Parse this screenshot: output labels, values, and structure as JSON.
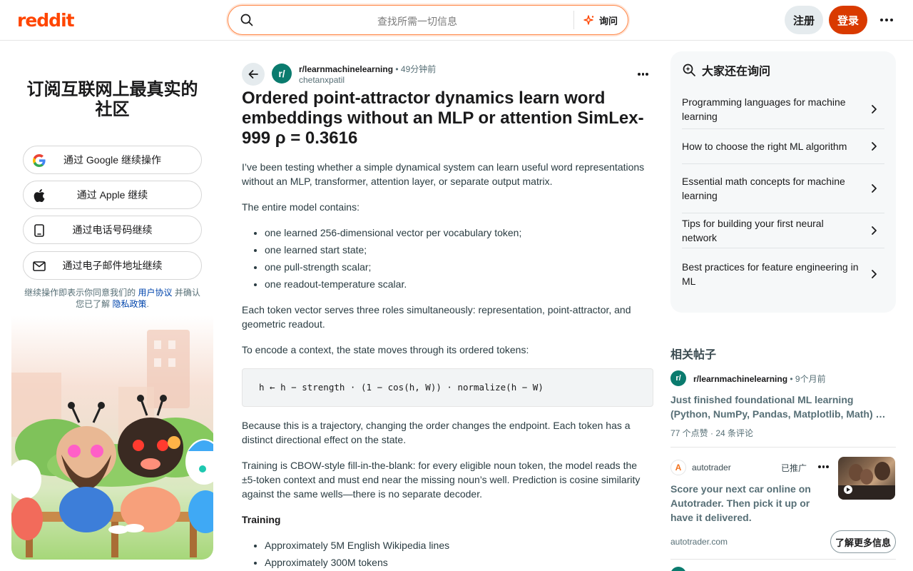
{
  "header": {
    "logo": "reddit",
    "search_placeholder": "查找所需一切信息",
    "ask_label": "询问",
    "signup_label": "注册",
    "login_label": "登录"
  },
  "left_card": {
    "title": "订阅互联网上最真实的社区",
    "buttons": [
      {
        "label": "通过 Google 继续操作",
        "icon": "google-icon"
      },
      {
        "label": "通过 Apple 继续",
        "icon": "apple-icon"
      },
      {
        "label": "通过电话号码继续",
        "icon": "phone-icon"
      },
      {
        "label": "通过电子邮件地址继续",
        "icon": "mail-icon"
      }
    ],
    "terms_prefix": "继续操作即表示你同意我们的",
    "terms_link": "用户协议",
    "terms_middle": "并确认您已了解",
    "privacy_link": "隐私政策",
    "terms_suffix": "."
  },
  "post": {
    "subreddit": "r/learnmachinelearning",
    "time": "• 49分钟前",
    "author": "chetanxpatil",
    "title": "Ordered point-attractor dynamics learn word embeddings without an MLP or attention SimLex-999 ρ = 0.3616",
    "p1": "I’ve been testing whether a simple dynamical system can learn useful word representations without an MLP, transformer, attention layer, or separate output matrix.",
    "p2": "The entire model contains:",
    "list1": [
      "one learned 256-dimensional vector per vocabulary token;",
      "one learned start state;",
      "one pull-strength scalar;",
      "one readout-temperature scalar."
    ],
    "p3": "Each token vector serves three roles simultaneously: representation, point-attractor, and geometric readout.",
    "p4": "To encode a context, the state moves through its ordered tokens:",
    "code": "h ← h − strength · (1 − cos(h, W)) · normalize(h − W)",
    "p5": "Because this is a trajectory, changing the order changes the endpoint. Each token has a distinct directional effect on the state.",
    "p6": "Training is CBOW-style fill-in-the-blank: for every eligible noun token, the model reads the ±5-token context and must end near the missing noun’s well. Prediction is cosine similarity against the same wells—there is no separate decoder.",
    "h_training": "Training",
    "list2": [
      "Approximately 5M English Wikipedia lines",
      "Approximately 300M tokens"
    ]
  },
  "ask_card": {
    "title": "大家还在询问",
    "items": [
      "Programming languages for machine learning",
      "How to choose the right ML algorithm",
      "Essential math concepts for machine learning",
      "Tips for building your first neural network",
      "Best practices for feature engineering in ML"
    ]
  },
  "related": {
    "title": "相关帖子",
    "post1": {
      "subreddit": "r/learnmachinelearning",
      "time": "• 9个月前",
      "title": "Just finished foundational ML learning (Python, NumPy, Pandas, Matplotlib, Math) …",
      "votes": "77 个点赞",
      "dot": "·",
      "comments": "24 条评论"
    },
    "ad": {
      "advertiser": "autotrader",
      "promoted": "已推广",
      "title": "Score your next car online on Autotrader. Then pick it up or have it delivered.",
      "domain": "autotrader.com",
      "cta": "了解更多信息"
    }
  },
  "colors": {
    "brand": "#ff4500",
    "login": "#d93a00",
    "link": "#0045ac",
    "subreddit_avatar": "#0a7b6e"
  }
}
